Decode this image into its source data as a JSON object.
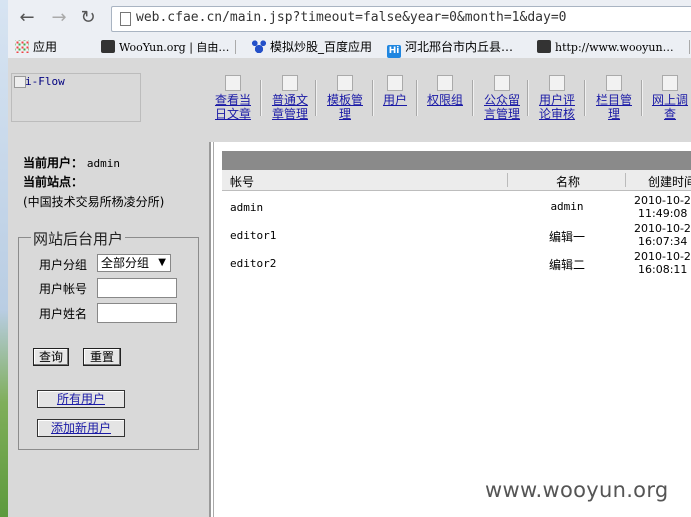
{
  "browser": {
    "url": "web.cfae.cn/main.jsp?timeout=false&year=0&month=1&day=0",
    "bookmarks": [
      {
        "label": "应用",
        "icon": "apps-grid-icon"
      },
      {
        "label": "WooYun.org | 自由…",
        "icon": "bookmark-site-icon"
      },
      {
        "label": "模拟炒股_百度应用",
        "icon": "baidu-paw-icon"
      },
      {
        "label": "河北邢台市内丘县…",
        "icon": "hi-icon"
      },
      {
        "label": "http://www.wooyun…",
        "icon": "bookmark-site-icon"
      }
    ]
  },
  "header": {
    "logo_alt": "i-Flow",
    "menu": [
      {
        "label": "查看当\n日文章"
      },
      {
        "label": "普通文\n章管理"
      },
      {
        "label": "模板管\n理"
      },
      {
        "label": "用户"
      },
      {
        "label": "权限组"
      },
      {
        "label": "公众留\n言管理"
      },
      {
        "label": "用户评\n论审核"
      },
      {
        "label": "栏目管\n理"
      },
      {
        "label": "网上调\n查"
      }
    ]
  },
  "sidebar": {
    "current_user_label": "当前用户：",
    "current_user_value": "admin",
    "current_site_label": "当前站点：",
    "current_site_value": "(中国技术交易所杨凌分所)",
    "group_title": "网站后台用户",
    "group_label": "用户分组",
    "group_value": "全部分组",
    "account_label": "用户帐号",
    "name_label": "用户姓名",
    "query_button": "查询",
    "reset_button": "重置",
    "all_users_button": "所有用户",
    "add_user_button": "添加新用户"
  },
  "table": {
    "headers": {
      "account": "帐号",
      "name": "名称",
      "created": "创建时间"
    },
    "rows": [
      {
        "account": "admin",
        "name": "admin",
        "created_date": "2010-10-2",
        "created_time": "11:49:08"
      },
      {
        "account": "editor1",
        "name": "编辑一",
        "created_date": "2010-10-2",
        "created_time": "16:07:34"
      },
      {
        "account": "editor2",
        "name": "编辑二",
        "created_date": "2010-10-2",
        "created_time": "16:08:11"
      }
    ]
  },
  "watermark": "www.wooyun.org",
  "colors": {
    "panel_bg": "#d9d9d9",
    "link": "#1a1aa6",
    "grid_bar": "#8a8a8a"
  }
}
